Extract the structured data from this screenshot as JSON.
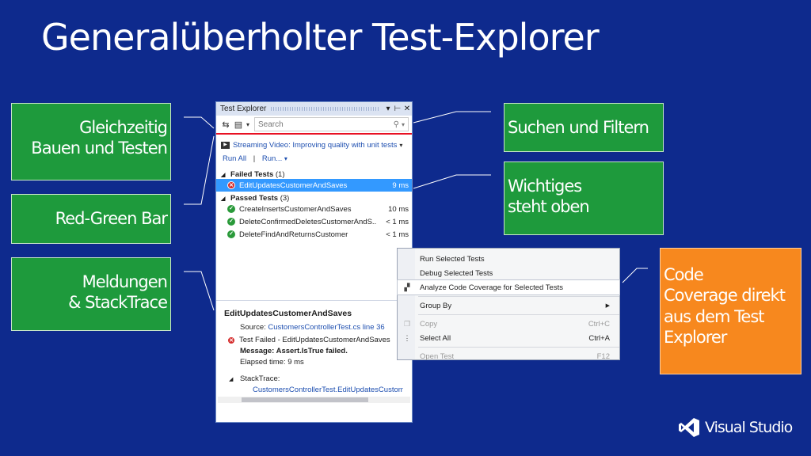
{
  "slide": {
    "title": "Generalüberholter Test-Explorer"
  },
  "callouts": {
    "build_test": "Gleichzeitig\nBauen und Testen",
    "red_green": "Red-Green Bar",
    "messages": "Meldungen\n& StackTrace",
    "search_filter": "Suchen und Filtern",
    "important": "Wichtiges\nsteht oben",
    "coverage": "Code\nCoverage direkt\naus dem Test\nExplorer"
  },
  "test_explorer": {
    "window_title": "Test Explorer",
    "search_placeholder": "Search",
    "banner": "Streaming Video: Improving quality with unit tests",
    "run_all": "Run All",
    "run_menu": "Run...",
    "failed_group": {
      "label": "Failed Tests",
      "count": "(1)"
    },
    "failed_tests": [
      {
        "name": "EditUpdatesCustomerAndSaves",
        "time": "9 ms"
      }
    ],
    "passed_group": {
      "label": "Passed Tests",
      "count": "(3)"
    },
    "passed_tests": [
      {
        "name": "CreateInsertsCustomerAndSaves",
        "time": "10 ms"
      },
      {
        "name": "DeleteConfirmedDeletesCustomerAndS...",
        "time": "< 1 ms"
      },
      {
        "name": "DeleteFindAndReturnsCustomer",
        "time": "< 1 ms"
      }
    ],
    "detail": {
      "heading": "EditUpdatesCustomerAndSaves",
      "source_label": "Source:",
      "source_link": "CustomersControllerTest.cs line 36",
      "failed_line": "Test Failed - EditUpdatesCustomerAndSaves",
      "message": "Message: Assert.IsTrue failed.",
      "elapsed": "Elapsed time: 9 ms",
      "stacktrace_label": "StackTrace:",
      "stacktrace_link": "CustomersControllerTest.EditUpdatesCustome"
    }
  },
  "context_menu": {
    "items": [
      {
        "label": "Run Selected Tests",
        "shortcut": ""
      },
      {
        "label": "Debug Selected Tests",
        "shortcut": ""
      },
      {
        "label": "Analyze Code Coverage for Selected Tests",
        "shortcut": ""
      },
      {
        "label": "Group By",
        "shortcut": ""
      },
      {
        "label": "Copy",
        "shortcut": "Ctrl+C"
      },
      {
        "label": "Select All",
        "shortcut": "Ctrl+A"
      },
      {
        "label": "Open Test",
        "shortcut": "F12"
      }
    ]
  },
  "brand": {
    "name": "Visual Studio"
  },
  "colors": {
    "background": "#0e2a8d",
    "callout_green": "#1e9a3c",
    "callout_orange": "#f7881e",
    "selection": "#3399ff",
    "fail": "#d42a2a",
    "pass": "#2a9a3a"
  }
}
